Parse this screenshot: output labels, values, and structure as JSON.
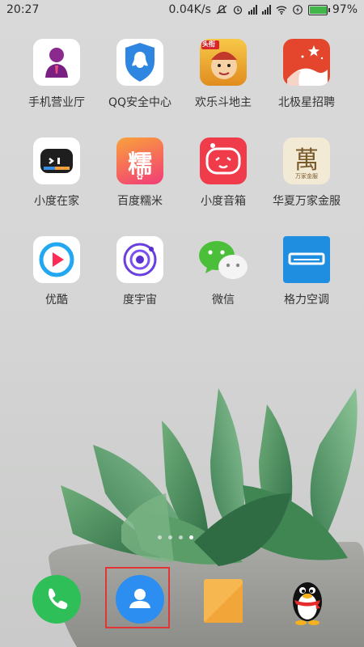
{
  "status_bar": {
    "time": "20:27",
    "network_speed": "0.04K/s",
    "battery_percent": "97%",
    "battery_level": 0.97
  },
  "apps": [
    {
      "label": "手机营业厅",
      "icon": "person-suit-icon",
      "color": "#ffffff"
    },
    {
      "label": "QQ安全中心",
      "icon": "shield-penguin-icon",
      "color": "#2f86e0"
    },
    {
      "label": "欢乐斗地主",
      "icon": "game-character-icon",
      "color": "#f4b429",
      "badge": "头衔"
    },
    {
      "label": "北极星招聘",
      "icon": "star-mountain-icon",
      "color": "#e4462d"
    },
    {
      "label": "小度在家",
      "icon": "robot-face-icon",
      "color": "#ffffff"
    },
    {
      "label": "百度糯米",
      "icon": "nuomi-icon",
      "color": "#f24a6a",
      "glyph": "糯"
    },
    {
      "label": "小度音箱",
      "icon": "speaker-face-icon",
      "color": "#f03b4a"
    },
    {
      "label": "华夏万家金服",
      "icon": "wan-character-icon",
      "color": "#f3ead6",
      "glyph": "萬",
      "subtext": "万家金服"
    },
    {
      "label": "优酷",
      "icon": "play-icon",
      "color": "#ffffff"
    },
    {
      "label": "度宇宙",
      "icon": "orbit-icon",
      "color": "#ffffff"
    },
    {
      "label": "微信",
      "icon": "chat-bubbles-icon",
      "color": "#4cbf3a"
    },
    {
      "label": "格力空调",
      "icon": "air-conditioner-icon",
      "color": "#1f8de0"
    }
  ],
  "page_indicator": {
    "count": 4,
    "active": 3
  },
  "dock": [
    {
      "name": "phone",
      "icon": "phone-icon",
      "color": "#2fbf59"
    },
    {
      "name": "contacts",
      "icon": "contacts-icon",
      "color": "#2b8ef0"
    },
    {
      "name": "notes",
      "icon": "notes-icon",
      "color": "#f6b650"
    },
    {
      "name": "qq",
      "icon": "qq-penguin-icon",
      "color": "#111111"
    }
  ]
}
